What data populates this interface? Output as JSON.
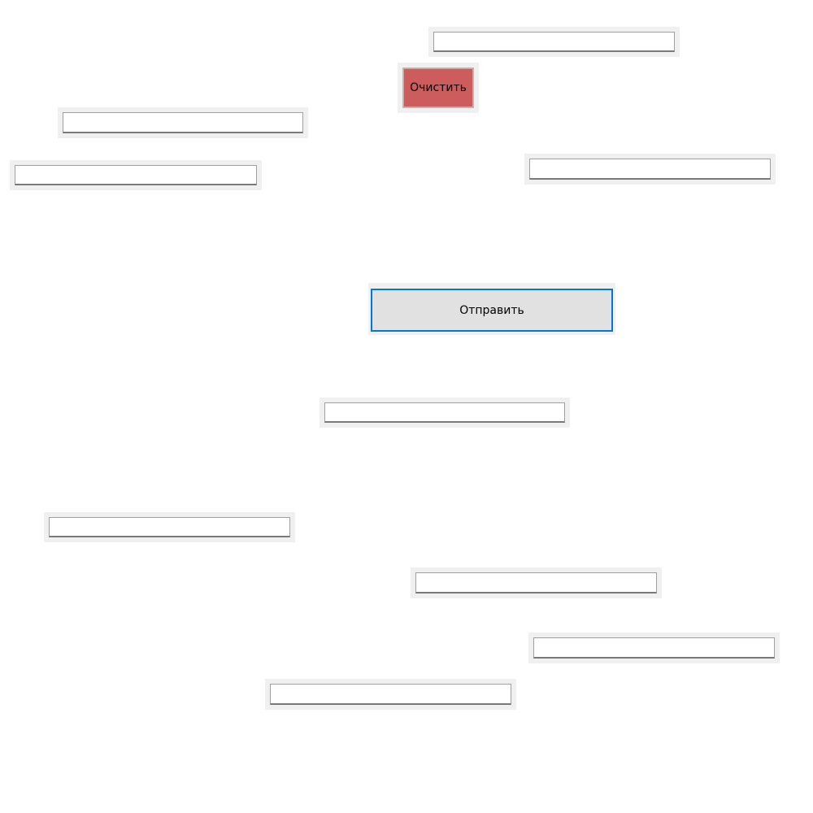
{
  "buttons": {
    "clear_label": "Очистить",
    "submit_label": "Отправить"
  },
  "fields": [
    {
      "value": "",
      "placeholder": ""
    },
    {
      "value": "",
      "placeholder": ""
    },
    {
      "value": "",
      "placeholder": ""
    },
    {
      "value": "",
      "placeholder": ""
    },
    {
      "value": "",
      "placeholder": ""
    },
    {
      "value": "",
      "placeholder": ""
    },
    {
      "value": "",
      "placeholder": ""
    },
    {
      "value": "",
      "placeholder": ""
    },
    {
      "value": "",
      "placeholder": ""
    }
  ],
  "colors": {
    "clear_button": "#cd5c5c",
    "submit_button": "#e1e1e1",
    "focus_border": "#0078d7",
    "frame": "#f0f0f0"
  }
}
